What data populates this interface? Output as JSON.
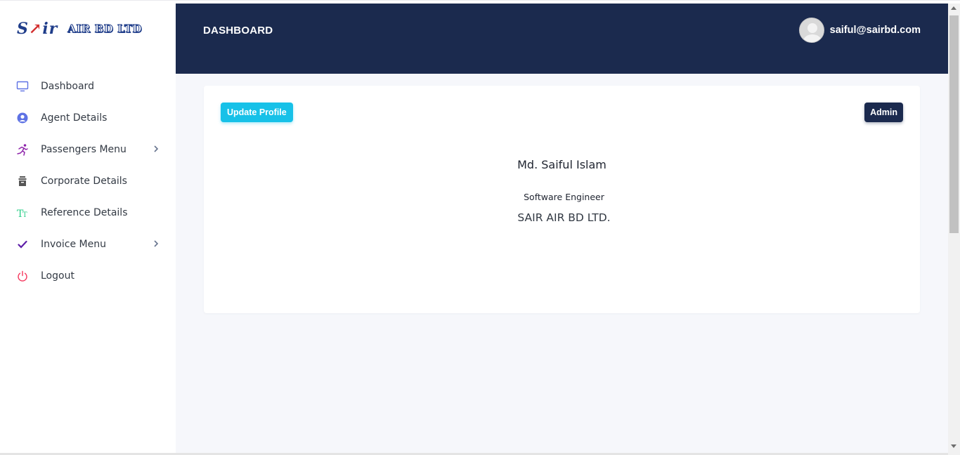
{
  "brand": {
    "logo_mark_a": "S",
    "logo_mark_b": "ir",
    "logo_text": "AIR BD LTD"
  },
  "sidebar": {
    "items": [
      {
        "label": "Dashboard",
        "icon": "monitor-icon",
        "color": "#5e72e4"
      },
      {
        "label": "Agent Details",
        "icon": "user-circle-icon",
        "color": "#5e72e4"
      },
      {
        "label": "Passengers Menu",
        "icon": "running-person-icon",
        "color": "#8e24aa",
        "has_submenu": true
      },
      {
        "label": "Corporate Details",
        "icon": "archive-icon",
        "color": "#555555"
      },
      {
        "label": "Reference Details",
        "icon": "text-size-icon",
        "color": "#2dce89"
      },
      {
        "label": "Invoice Menu",
        "icon": "check-icon",
        "color": "#5e1fa8",
        "has_submenu": true
      },
      {
        "label": "Logout",
        "icon": "power-icon",
        "color": "#f5365c"
      }
    ]
  },
  "header": {
    "title": "DASHBOARD",
    "user_email": "saiful@sairbd.com",
    "background": "#1b2a4e"
  },
  "profile": {
    "update_button": "Update Profile",
    "role_badge": "Admin",
    "name": "Md. Saiful Islam",
    "designation": "Software Engineer",
    "company": "SAIR AIR BD LTD."
  },
  "colors": {
    "accent_cyan": "#17c1e8",
    "navy": "#1b2a4e",
    "main_bg": "#f6f7fb"
  }
}
